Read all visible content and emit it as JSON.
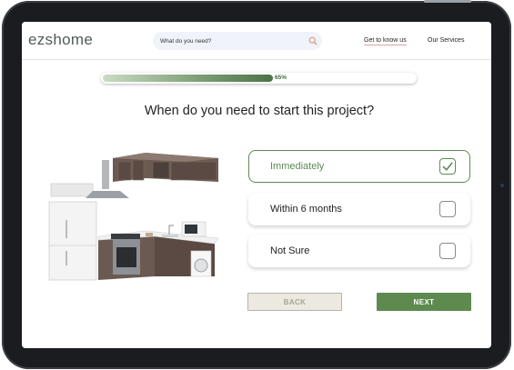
{
  "header": {
    "logo": "ezshome",
    "search_placeholder": "What do you need?",
    "nav": [
      {
        "label": "Get to know us"
      },
      {
        "label": "Our Services"
      }
    ]
  },
  "progress": {
    "value": 0.65,
    "label": "65%"
  },
  "question": "When do you need to start this project?",
  "options": [
    {
      "label": "Immediately",
      "selected": true
    },
    {
      "label": "Within 6 months",
      "selected": false
    },
    {
      "label": "Not Sure",
      "selected": false
    }
  ],
  "buttons": {
    "back": "BACK",
    "next": "NEXT"
  },
  "colors": {
    "accent": "#5e8a50",
    "logo": "#4f5d55",
    "back_button_bg": "#ece9e1"
  },
  "icons": {
    "search": "search-icon",
    "check": "check-icon",
    "illustration": "kitchen-illustration"
  }
}
